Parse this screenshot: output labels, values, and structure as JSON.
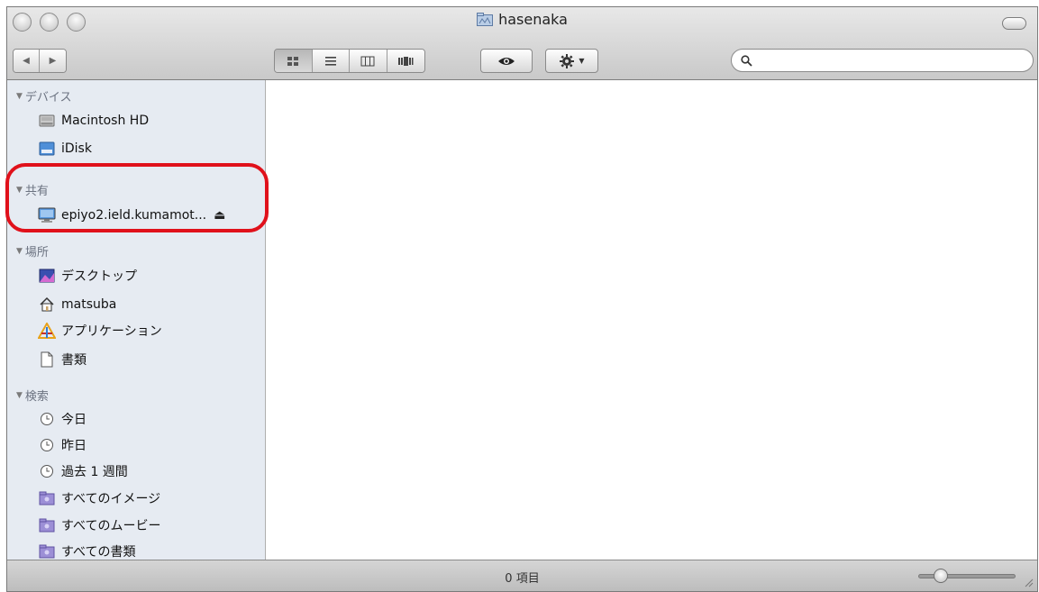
{
  "window": {
    "title": "hasenaka"
  },
  "toolbar": {
    "nav_back": "◀",
    "nav_forward": "▶",
    "view_modes": [
      "icon-view",
      "list-view",
      "column-view",
      "coverflow-view"
    ],
    "active_view": "icon-view",
    "search": {
      "placeholder": "",
      "value": ""
    }
  },
  "sidebar": {
    "sections": {
      "devices": {
        "label": "デバイス"
      },
      "shared": {
        "label": "共有"
      },
      "places": {
        "label": "場所"
      },
      "search": {
        "label": "検索"
      }
    },
    "devices": [
      {
        "label": "Macintosh HD",
        "icon": "hard-drive-icon"
      },
      {
        "label": "iDisk",
        "icon": "idisk-icon"
      }
    ],
    "shared": [
      {
        "label": "epiyo2.ield.kumamot...",
        "icon": "server-icon",
        "eject": "⏏"
      }
    ],
    "places": [
      {
        "label": "デスクトップ",
        "icon": "desktop-icon"
      },
      {
        "label": "matsuba",
        "icon": "home-icon"
      },
      {
        "label": "アプリケーション",
        "icon": "applications-icon"
      },
      {
        "label": "書類",
        "icon": "documents-icon"
      }
    ],
    "search_items": [
      {
        "label": "今日",
        "icon": "clock-icon"
      },
      {
        "label": "昨日",
        "icon": "clock-icon"
      },
      {
        "label": "過去 1 週間",
        "icon": "clock-icon"
      },
      {
        "label": "すべてのイメージ",
        "icon": "smart-folder-icon"
      },
      {
        "label": "すべてのムービー",
        "icon": "smart-folder-icon"
      },
      {
        "label": "すべての書類",
        "icon": "smart-folder-icon"
      }
    ]
  },
  "statusbar": {
    "text": "0 項目",
    "zoom_level": 0.18
  },
  "colors": {
    "highlight": "#e0111b",
    "sidebar_bg": "#e6ebf2"
  }
}
